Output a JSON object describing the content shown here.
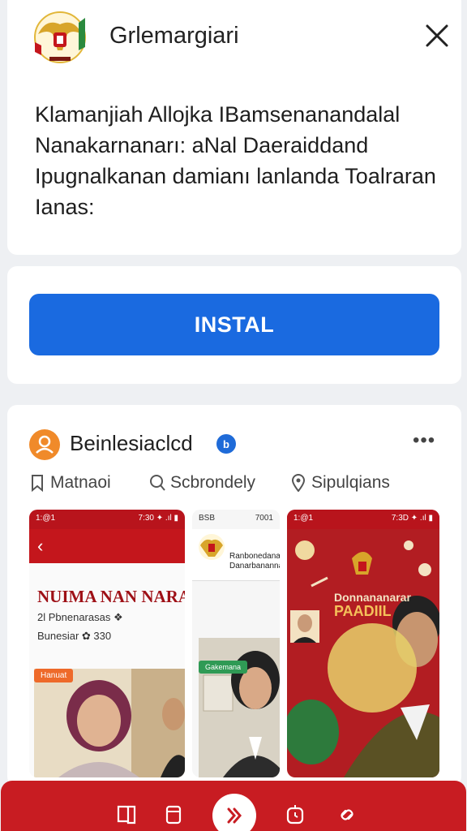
{
  "header": {
    "app_name": "Grlemargiari",
    "description": "Klamanjiah Allojka IBamsenanandalal Nanakarnanarı: aNal Daeraiddand Ipugnalkanan damianı lanlanda Toalraran Ianas:"
  },
  "install": {
    "label": "INSTAL"
  },
  "feed": {
    "profile_name": "Beinlesiaclcd",
    "verified_mark": "b",
    "more_label": "•••",
    "tags": [
      {
        "label": "Matnaoi",
        "icon": "bookmark-icon"
      },
      {
        "label": "Scbrondely",
        "icon": "search-icon"
      },
      {
        "label": "Sipulqians",
        "icon": "location-pin-icon"
      }
    ],
    "screenshots": {
      "s1_status_left": "1:@1",
      "s1_status_right": "7:30 ✦ .ıl ▮",
      "s1_title": "NUIMA NAN NARA",
      "s1_sub": "2l Pbnenarasas ❖",
      "s1_sub2": "Bunesiar ✿ 330",
      "s1_badge": "Hanuat",
      "s2_status_left": "BSB",
      "s2_status_right": "7001",
      "s2_title": "Ranbonedanan Danarbananna",
      "s2_badge": "Gakemana",
      "s3_status_left": "1:@1",
      "s3_status_right": "7:3D ✦ .ıl ▮",
      "s3_title": "Donnananarar",
      "s3_title2": "PAADIIL"
    }
  },
  "colors": {
    "accent_blue": "#1a6ae0",
    "brand_red": "#c81c22",
    "avatar_orange": "#f08a2a"
  }
}
